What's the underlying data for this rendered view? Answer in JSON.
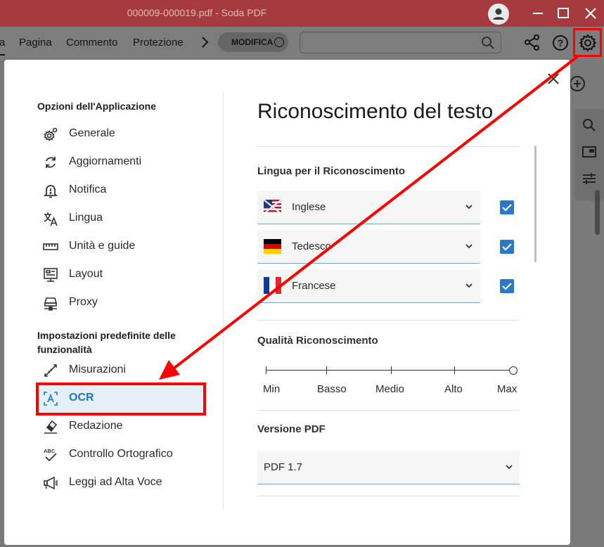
{
  "window": {
    "title": "000009-000019.pdf  -  Soda PDF"
  },
  "menu": {
    "tabs": [
      {
        "label": "a"
      },
      {
        "label": "Pagina"
      },
      {
        "label": "Commento"
      },
      {
        "label": "Protezione"
      }
    ],
    "modifica_label": "MODIFICA",
    "search_placeholder": ""
  },
  "dialog": {
    "sidebar": {
      "app_options_heading": "Opzioni dell'Applicazione",
      "app_items": [
        {
          "label": "Generale",
          "icon": "gear-cog-icon"
        },
        {
          "label": "Aggiornamenti",
          "icon": "refresh-icon"
        },
        {
          "label": "Notifica",
          "icon": "bell-icon"
        },
        {
          "label": "Lingua",
          "icon": "translate-icon"
        },
        {
          "label": "Unità e guide",
          "icon": "ruler-icon"
        },
        {
          "label": "Layout",
          "icon": "layout-icon"
        },
        {
          "label": "Proxy",
          "icon": "network-icon"
        }
      ],
      "defaults_heading_line1": "Impostazioni predefinite delle",
      "defaults_heading_line2": "funzionalità",
      "default_items": [
        {
          "label": "Misurazioni",
          "icon": "measure-icon"
        },
        {
          "label": "OCR",
          "icon": "ocr-icon"
        },
        {
          "label": "Redazione",
          "icon": "eraser-icon"
        },
        {
          "label": "Controllo Ortografico",
          "icon": "spellcheck-icon"
        },
        {
          "label": "Leggi ad Alta Voce",
          "icon": "megaphone-icon"
        }
      ],
      "selected": "OCR"
    },
    "content": {
      "title": "Riconoscimento del testo",
      "language_heading": "Lingua per il Riconoscimento",
      "languages": [
        {
          "name": "Inglese",
          "checked": true,
          "flag": "us-flag"
        },
        {
          "name": "Tedesco",
          "checked": true,
          "flag": "de-flag"
        },
        {
          "name": "Francese",
          "checked": true,
          "flag": "fr-flag"
        }
      ],
      "quality_heading": "Qualità Riconoscimento",
      "quality_levels": [
        "Min",
        "Basso",
        "Medio",
        "Alto",
        "Max"
      ],
      "quality_selected": "Max",
      "pdf_version_heading": "Versione PDF",
      "pdf_version_value": "PDF 1.7"
    }
  },
  "colors": {
    "titlebar": "#a53b3e",
    "accent": "#1976d2",
    "checkbox": "#2979c9",
    "highlight": "#ff0000"
  }
}
